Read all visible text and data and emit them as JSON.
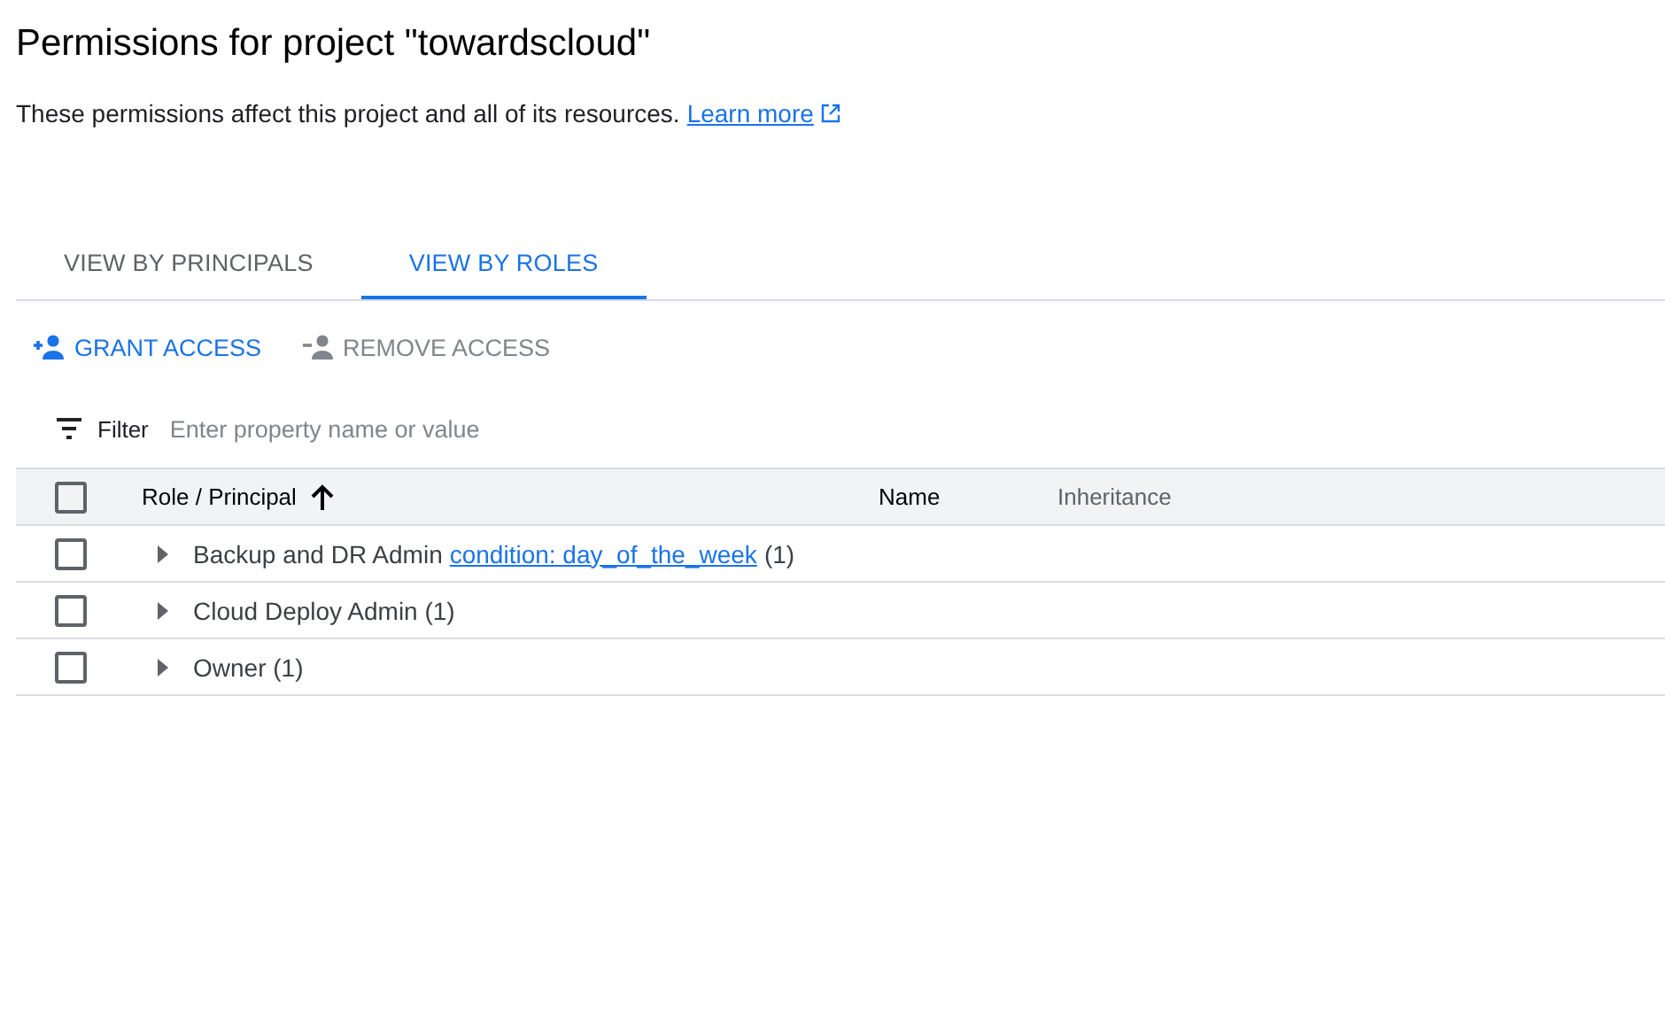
{
  "title": "Permissions for project \"towardscloud\"",
  "description": {
    "text": "These permissions affect this project and all of its resources.",
    "link": "Learn more"
  },
  "tabs": [
    {
      "label": "VIEW BY PRINCIPALS",
      "selected": false
    },
    {
      "label": "VIEW BY ROLES",
      "selected": true
    }
  ],
  "actions": [
    {
      "label": "GRANT ACCESS",
      "kind": "add",
      "disabled": false
    },
    {
      "label": "REMOVE ACCESS",
      "kind": "remove",
      "disabled": true
    }
  ],
  "filter": {
    "label": "Filter",
    "placeholder": "Enter property name or value"
  },
  "table": {
    "select_all_checked": false,
    "columns": [
      {
        "label": "Role / Principal",
        "sorted": true
      },
      {
        "label": "Name",
        "sorted": false
      },
      {
        "label": "Inheritance",
        "sorted": false
      }
    ],
    "rows": [
      {
        "role": "Backup and DR Admin",
        "condition": "condition: day_of_the_week",
        "count": "(1)",
        "checked": false,
        "expanded": false
      },
      {
        "role": "Cloud Deploy Admin (1)",
        "checked": false,
        "expanded": false
      },
      {
        "role": "Owner (1)",
        "checked": false,
        "expanded": false
      }
    ]
  }
}
